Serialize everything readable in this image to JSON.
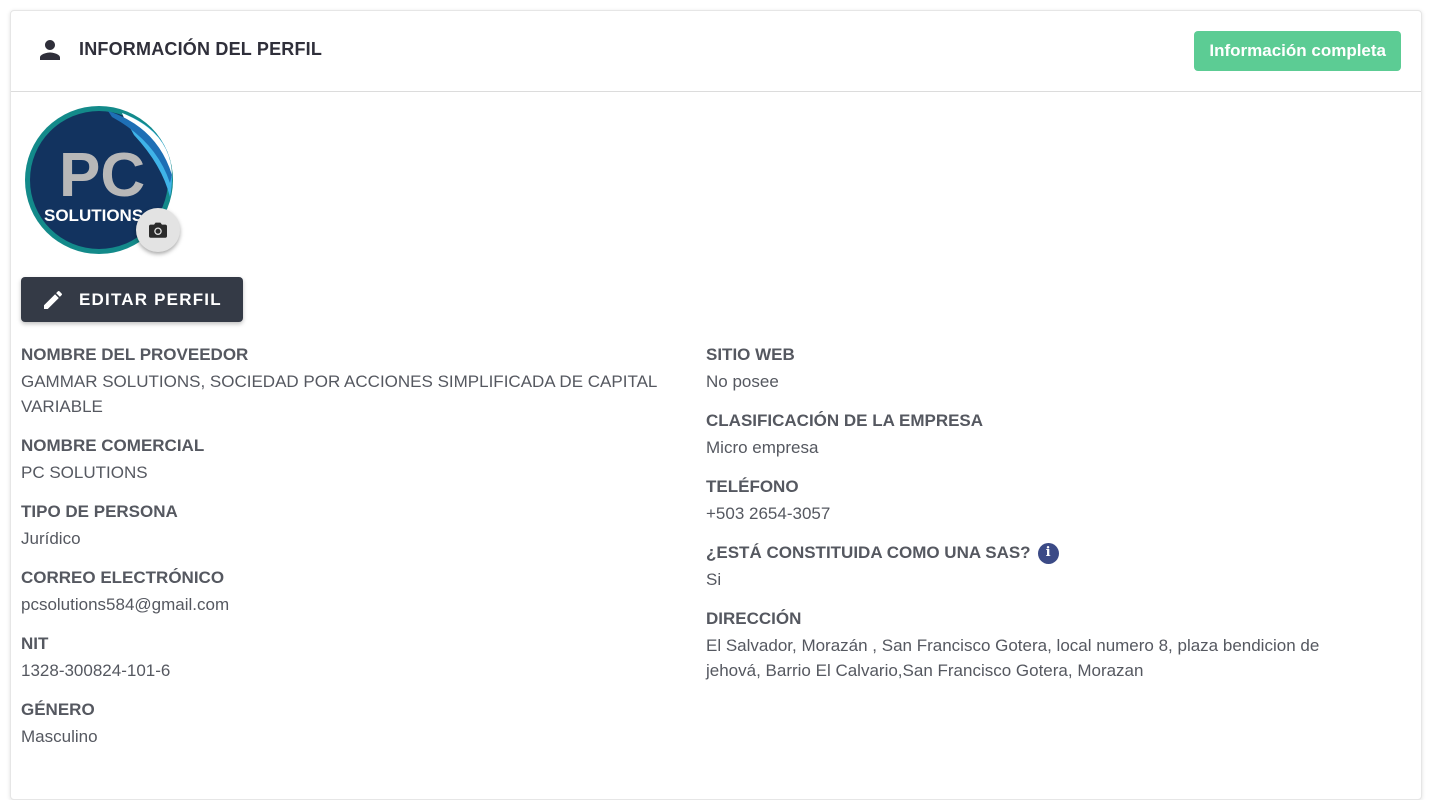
{
  "header": {
    "title": "INFORMACIÓN DEL PERFIL",
    "status_badge": "Información completa",
    "icon": "person-icon"
  },
  "avatar": {
    "logo_line1": "PC",
    "logo_line2": "SOLUTIONS",
    "camera_icon": "camera-icon"
  },
  "actions": {
    "edit_label": "EDITAR PERFIL",
    "edit_icon": "pencil-icon"
  },
  "left_fields": [
    {
      "label": "NOMBRE DEL PROVEEDOR",
      "value": "GAMMAR SOLUTIONS, SOCIEDAD POR ACCIONES SIMPLIFICADA DE CAPITAL VARIABLE"
    },
    {
      "label": "NOMBRE COMERCIAL",
      "value": "PC SOLUTIONS"
    },
    {
      "label": "TIPO DE PERSONA",
      "value": "Jurídico"
    },
    {
      "label": "CORREO ELECTRÓNICO",
      "value": "pcsolutions584@gmail.com"
    },
    {
      "label": "NIT",
      "value": "1328-300824-101-6"
    },
    {
      "label": "GÉNERO",
      "value": "Masculino"
    }
  ],
  "right_fields": [
    {
      "label": "SITIO WEB",
      "value": "No posee"
    },
    {
      "label": "CLASIFICACIÓN DE LA EMPRESA",
      "value": "Micro empresa"
    },
    {
      "label": "TELÉFONO",
      "value": "+503 2654-3057"
    },
    {
      "label": "¿ESTÁ CONSTITUIDA COMO UNA SAS?",
      "value": "Si",
      "info_icon": "i"
    },
    {
      "label": "DIRECCIÓN",
      "value": "El Salvador, Morazán , San Francisco Gotera, local numero 8, plaza bendicion de jehová, Barrio El Calvario,San Francisco Gotera, Morazan"
    }
  ],
  "colors": {
    "badge": "#5ccc94",
    "edit_button": "#343a46",
    "info_icon": "#3b4a86",
    "logo_navy": "#12335f",
    "logo_teal": "#138a8a",
    "logo_lightblue": "#3fb3e8"
  }
}
